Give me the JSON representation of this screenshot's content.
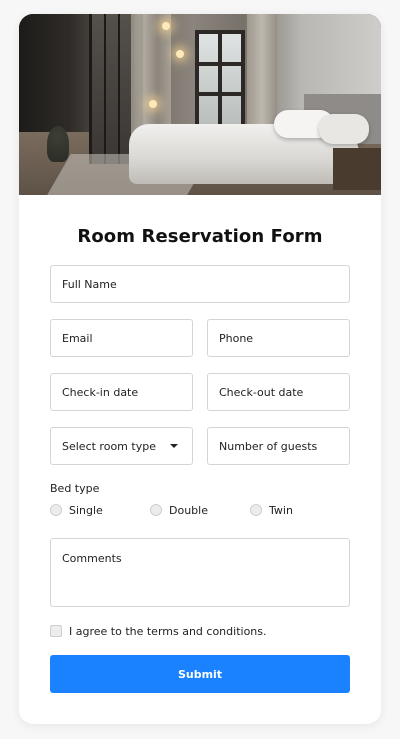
{
  "form": {
    "title": "Room Reservation Form",
    "full_name_placeholder": "Full Name",
    "email_placeholder": "Email",
    "phone_placeholder": "Phone",
    "checkin_placeholder": "Check-in date",
    "checkout_placeholder": "Check-out date",
    "room_type_selected": "Select room type",
    "guests_placeholder": "Number of guests",
    "bed_type_label": "Bed type",
    "bed_options": [
      "Single",
      "Double",
      "Twin"
    ],
    "comments_placeholder": "Comments",
    "terms_label": "I agree to the terms and conditions.",
    "submit_label": "Submit"
  },
  "colors": {
    "accent": "#1a82ff",
    "background": "#f7f7f8",
    "card": "#ffffff",
    "field_border": "#d5d5d5"
  },
  "icons": {
    "select_caret": "caret-down-icon"
  }
}
